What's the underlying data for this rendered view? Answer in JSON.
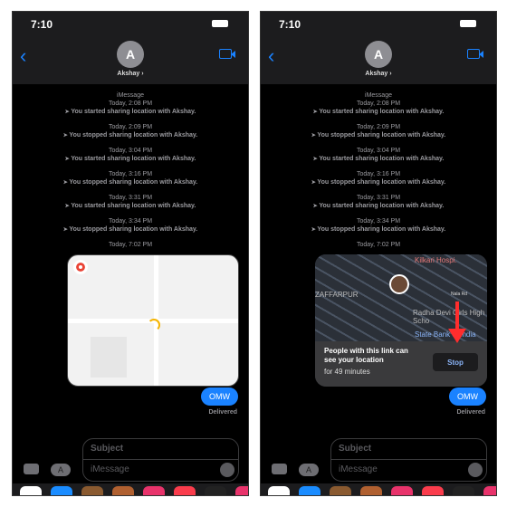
{
  "status": {
    "time": "7:10"
  },
  "header": {
    "avatar_initial": "A",
    "contact_name": "Akshay ›"
  },
  "conversation": {
    "service": "iMessage",
    "events": [
      {
        "time": "Today, 2:08 PM",
        "text": "You started sharing location with Akshay."
      },
      {
        "time": "Today, 2:09 PM",
        "text": "You stopped sharing location with Akshay."
      },
      {
        "time": "Today, 3:04 PM",
        "text": "You started sharing location with Akshay."
      },
      {
        "time": "Today, 3:16 PM",
        "text": "You stopped sharing location with Akshay."
      },
      {
        "time": "Today, 3:31 PM",
        "text": "You started sharing location with Akshay."
      },
      {
        "time": "Today, 3:34 PM",
        "text": "You stopped sharing location with Akshay."
      }
    ],
    "last_time": "Today, 7:02 PM",
    "bubble": "OMW",
    "delivered": "Delivered"
  },
  "map_card": {
    "labels": [
      "Kilkari Hospi.",
      "ZAFFARPUR",
      "Radha Devi Girls High Scho",
      "State Bank of India",
      "Nala Rd"
    ],
    "info_line1": "People with this link can",
    "info_line2": "see your location",
    "duration": "for 49 minutes",
    "stop_label": "Stop"
  },
  "composer": {
    "subject_placeholder": "Subject",
    "message_placeholder": "iMessage"
  },
  "colors": {
    "accent": "#1a82ff",
    "annotation_arrow": "#ff2d2d"
  }
}
